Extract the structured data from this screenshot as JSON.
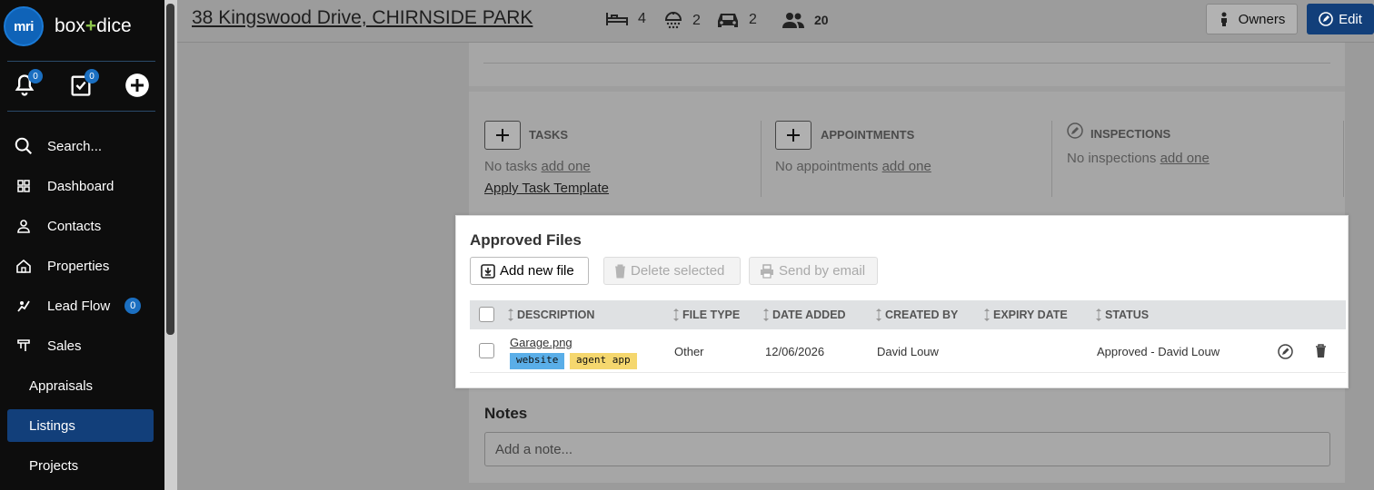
{
  "sidebar": {
    "logo_text": "mri",
    "brand_part1": "box",
    "brand_plus": "+",
    "brand_part2": "dice",
    "notifications_count": "0",
    "tasks_count": "0",
    "items": [
      {
        "label": "Search...",
        "icon": "search-icon"
      },
      {
        "label": "Dashboard",
        "icon": "dashboard-icon"
      },
      {
        "label": "Contacts",
        "icon": "person-icon"
      },
      {
        "label": "Properties",
        "icon": "home-icon"
      },
      {
        "label": "Lead Flow",
        "icon": "lead-flow-icon",
        "badge": "0"
      },
      {
        "label": "Sales",
        "icon": "sales-icon"
      },
      {
        "label": "Appraisals"
      },
      {
        "label": "Listings",
        "active": true
      },
      {
        "label": "Projects"
      }
    ]
  },
  "header": {
    "address": "38 Kingswood Drive, CHIRNSIDE PARK",
    "bedrooms": "4",
    "bathrooms": "2",
    "cars": "2",
    "contacts": "20",
    "owners_label": "Owners",
    "edit_label": "Edit"
  },
  "panel": {
    "tasks": {
      "title": "TASKS",
      "empty_text": "No tasks",
      "add_link": "add one",
      "template_link": "Apply Task Template"
    },
    "appointments": {
      "title": "APPOINTMENTS",
      "empty_text": "No appointments",
      "add_link": "add one"
    },
    "inspections": {
      "title": "INSPECTIONS",
      "empty_text": "No inspections",
      "add_link": "add one"
    }
  },
  "files": {
    "title": "Approved Files",
    "add_label": "Add new file",
    "delete_label": "Delete selected",
    "email_label": "Send by email",
    "columns": [
      "DESCRIPTION",
      "FILE TYPE",
      "DATE ADDED",
      "CREATED BY",
      "EXPIRY DATE",
      "STATUS"
    ],
    "rows": [
      {
        "description": "Garage.png",
        "tags": [
          "website",
          "agent app"
        ],
        "file_type": "Other",
        "date_added": "12/06/2026",
        "created_by": "David Louw",
        "expiry_date": "",
        "status": "Approved - David Louw"
      }
    ],
    "tag_colors": {
      "website": "#5aaee8",
      "agent app": "#f5d76e"
    }
  },
  "notes": {
    "title": "Notes",
    "placeholder": "Add a note..."
  },
  "colors": {
    "accent": "#123f7a",
    "badge": "#1b6fc1"
  }
}
